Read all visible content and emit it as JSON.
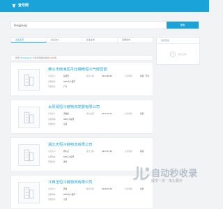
{
  "header": {
    "brand": "查号网",
    "accent": "#1aa3d9"
  },
  "search": {
    "value": "fengjiang",
    "button_label": "搜索"
  },
  "tabs": [
    "企业名称",
    "企业法人",
    "企业业务",
    "注册资本"
  ],
  "results_note": {
    "prefix": "搜索 ",
    "keyword": "\"fengjiang\"",
    "middle": " 为您找到相关信息",
    "count": "1000",
    "suffix": "家"
  },
  "companies": [
    {
      "name": "佛山市南海区丹灶镇畅恒冷气经营部",
      "fields": [
        {
          "label": "企业法人:",
          "value": "彭锦洪"
        },
        {
          "label": "成立日期:",
          "value": "2014-08-02"
        },
        {
          "label": "企业状态:",
          "value": "存续、开业"
        },
        {
          "label": "注册资本:",
          "value": "0000万人民币"
        },
        {
          "label": "所属省份:",
          "value": "广东"
        }
      ]
    },
    {
      "name": "太原润恒冷链物流发展有限公司",
      "fields": [
        {
          "label": "企业法人:",
          "value": "宋俊霞"
        },
        {
          "label": "成立日期:",
          "value": "2014-10-21"
        },
        {
          "label": "企业状态:",
          "value": "存续"
        },
        {
          "label": "注册资本:",
          "value": "500万人民币"
        },
        {
          "label": "所属省份:",
          "value": "山西"
        }
      ]
    },
    {
      "name": "湖北天恒冷链物流有限公司",
      "fields": [
        {
          "label": "企业法人:",
          "value": "周小龙"
        },
        {
          "label": "成立日期:",
          "value": "2017-07-20"
        },
        {
          "label": "企业状态:",
          "value": "存续"
        },
        {
          "label": "注册资本:",
          "value": "500万人民币"
        },
        {
          "label": "所属省份:",
          "value": "湖北"
        }
      ]
    },
    {
      "name": "江西玉恒冷链物流有限公司",
      "fields": [
        {
          "label": "企业法人:",
          "value": "周旭"
        },
        {
          "label": "成立日期:",
          "value": "2016-03-04"
        },
        {
          "label": "企业状态:",
          "value": "存续"
        },
        {
          "label": "注册资本:",
          "value": "5000万人民币"
        },
        {
          "label": "所属省份:",
          "value": "江西"
        }
      ]
    }
  ],
  "sidebar": {
    "title": "浏览历史",
    "empty_text": "暂无记录"
  },
  "watermark": {
    "title": "自动秒收录",
    "subtitle": "提交一次 · 永久展示"
  }
}
